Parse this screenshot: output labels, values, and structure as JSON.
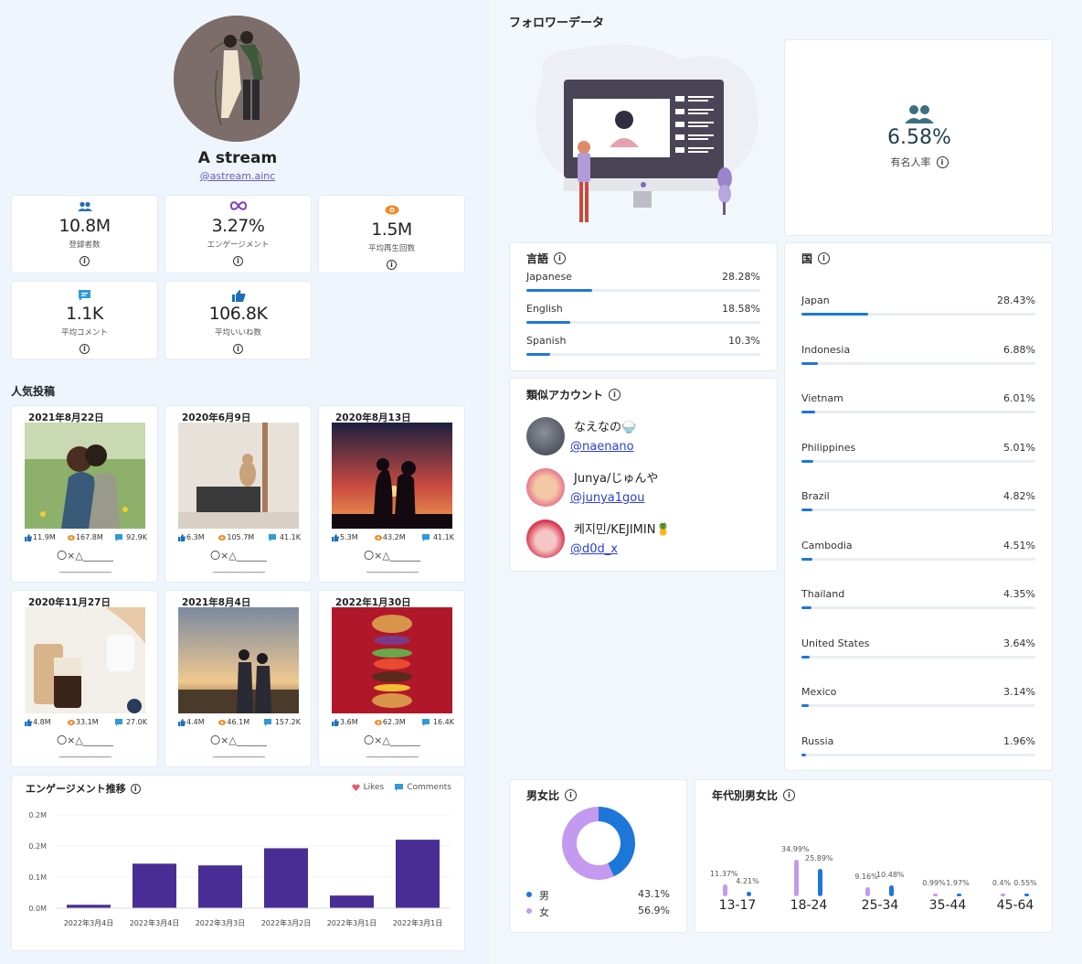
{
  "profile": {
    "name": "A stream",
    "handle": "@astream.ainc"
  },
  "stats": [
    {
      "icon": "people-icon",
      "value": "10.8M",
      "label": "登録者数"
    },
    {
      "icon": "infinity-icon",
      "value": "3.27%",
      "label": "エンゲージメント"
    },
    {
      "icon": "eye-icon",
      "value": "1.5M",
      "label": "平均再生回数"
    },
    {
      "icon": "comment-icon",
      "value": "1.1K",
      "label": "平均コメント"
    },
    {
      "icon": "thumbs-up-icon",
      "value": "106.8K",
      "label": "平均いいね数"
    }
  ],
  "popular_title": "人気投稿",
  "posts": [
    {
      "date": "2021年8月22日",
      "likes": "11.9M",
      "views": "167.8M",
      "comments": "92.9K",
      "caption": "〇×△______",
      "caption2": "______________"
    },
    {
      "date": "2020年6月9日",
      "likes": "6.3M",
      "views": "105.7M",
      "comments": "41.1K",
      "caption": "〇×△______",
      "caption2": "______________"
    },
    {
      "date": "2020年8月13日",
      "likes": "5.3M",
      "views": "43.2M",
      "comments": "41.1K",
      "caption": "〇×△______",
      "caption2": "______________"
    },
    {
      "date": "2020年11月27日",
      "likes": "4.8M",
      "views": "33.1M",
      "comments": "27.0K",
      "caption": "〇×△______",
      "caption2": "______________"
    },
    {
      "date": "2021年8月4日",
      "likes": "4.4M",
      "views": "46.1M",
      "comments": "157.2K",
      "caption": "〇×△______",
      "caption2": "______________"
    },
    {
      "date": "2022年1月30日",
      "likes": "3.6M",
      "views": "62.3M",
      "comments": "16.4K",
      "caption": "〇×△______",
      "caption2": "______________"
    }
  ],
  "engagement": {
    "title": "エンゲージメント推移",
    "legend_likes": "Likes",
    "legend_comments": "Comments",
    "colors": {
      "bar": "#4a2d94",
      "likes": "#e05a6a",
      "comments": "#2f9ad8"
    }
  },
  "chart_data": {
    "type": "bar",
    "categories": [
      "2022年3月4日",
      "2022年3月4日",
      "2022年3月3日",
      "2022年3月2日",
      "2022年3月1日",
      "2022年3月1日"
    ],
    "series": [
      {
        "values": [
          0.01,
          0.13,
          0.125,
          0.175,
          0.037,
          0.2
        ]
      }
    ],
    "yticks": [
      "0.0M",
      "0.1M",
      "0.2M",
      "0.2M"
    ],
    "ylim": [
      0,
      0.275
    ],
    "grid": true,
    "legend": "top-right"
  },
  "follower": {
    "title": "フォロワーデータ",
    "celebrity_value": "6.58%",
    "celebrity_label": "有名人率",
    "language_title": "言語",
    "languages": [
      {
        "name": "Japanese",
        "pct": "28.28%",
        "ratio": 0.2828
      },
      {
        "name": "English",
        "pct": "18.58%",
        "ratio": 0.1858
      },
      {
        "name": "Spanish",
        "pct": "10.3%",
        "ratio": 0.103
      }
    ],
    "country_title": "国",
    "countries": [
      {
        "name": "Japan",
        "pct": "28.43%",
        "ratio": 0.2843
      },
      {
        "name": "Indonesia",
        "pct": "6.88%",
        "ratio": 0.0688
      },
      {
        "name": "Vietnam",
        "pct": "6.01%",
        "ratio": 0.0601
      },
      {
        "name": "Philippines",
        "pct": "5.01%",
        "ratio": 0.0501
      },
      {
        "name": "Brazil",
        "pct": "4.82%",
        "ratio": 0.0482
      },
      {
        "name": "Cambodia",
        "pct": "4.51%",
        "ratio": 0.0451
      },
      {
        "name": "Thailand",
        "pct": "4.35%",
        "ratio": 0.0435
      },
      {
        "name": "United States",
        "pct": "3.64%",
        "ratio": 0.0364
      },
      {
        "name": "Mexico",
        "pct": "3.14%",
        "ratio": 0.0314
      },
      {
        "name": "Russia",
        "pct": "1.96%",
        "ratio": 0.0196
      }
    ],
    "similar_title": "類似アカウント",
    "similar": [
      {
        "name": "なえなの🍚",
        "handle": "@naenano"
      },
      {
        "name": "Junya/じゅんや",
        "handle": "@junya1gou"
      },
      {
        "name": "케지민/KEJIMIN🍍",
        "handle": "@d0d_x"
      }
    ],
    "gender_title": "男女比",
    "gender": [
      {
        "label": "男",
        "pct": "43.1%",
        "ratio": 0.431,
        "color": "#1d77d8"
      },
      {
        "label": "女",
        "pct": "56.9%",
        "ratio": 0.569,
        "color": "#c49af0"
      }
    ],
    "age_title": "年代別男女比",
    "ages": [
      {
        "range": "13-17",
        "female": "11.37%",
        "male": "4.21%",
        "f": 0.1137,
        "m": 0.0421
      },
      {
        "range": "18-24",
        "female": "34.99%",
        "male": "25.89%",
        "f": 0.3499,
        "m": 0.2589
      },
      {
        "range": "25-34",
        "female": "9.16%",
        "male": "10.48%",
        "f": 0.0916,
        "m": 0.1048
      },
      {
        "range": "35-44",
        "female": "0.99%",
        "male": "1.97%",
        "f": 0.0099,
        "m": 0.0197
      },
      {
        "range": "45-64",
        "female": "0.4%",
        "male": "0.55%",
        "f": 0.004,
        "m": 0.0055
      }
    ]
  }
}
